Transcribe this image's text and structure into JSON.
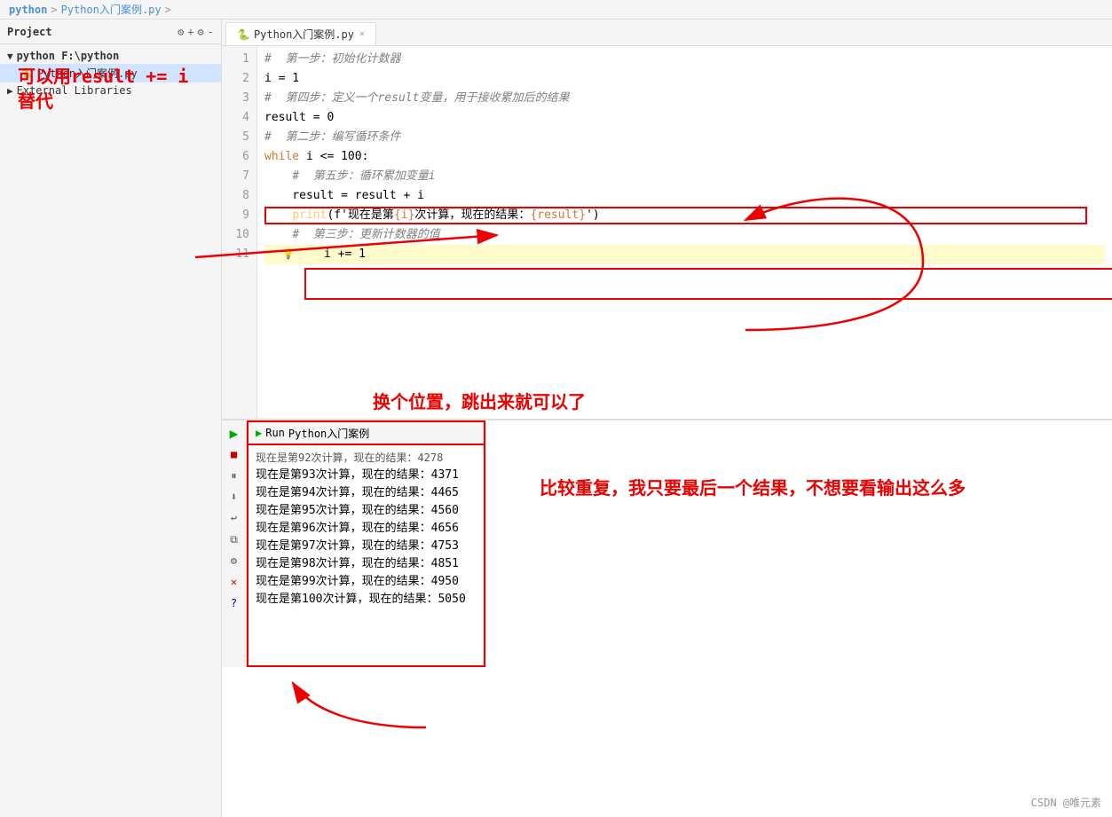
{
  "breadcrumb": {
    "parts": [
      "python",
      ">",
      "Python入门案例.py",
      ">"
    ]
  },
  "sidebar": {
    "title": "Project",
    "items": [
      {
        "label": "python  F:\\python",
        "type": "root",
        "icon": "▼"
      },
      {
        "label": "Python入门案例.py",
        "type": "file",
        "icon": "🐍"
      },
      {
        "label": "External Libraries",
        "type": "lib",
        "icon": "▶ ||||"
      }
    ]
  },
  "editor": {
    "tab": {
      "label": "Python入门案例.py",
      "close": "✕"
    },
    "lines": [
      {
        "num": 1,
        "code": "#  第一步：初始化计数器",
        "type": "comment"
      },
      {
        "num": 2,
        "code": "i = 1",
        "type": "code"
      },
      {
        "num": 3,
        "code": "#  第四步：定义一个result变量，用于接收累加后的结果",
        "type": "comment"
      },
      {
        "num": 4,
        "code": "result = 0",
        "type": "code"
      },
      {
        "num": 5,
        "code": "#  第二步：编写循环条件",
        "type": "comment"
      },
      {
        "num": 6,
        "code": "while i <= 100:",
        "type": "code"
      },
      {
        "num": 7,
        "code": "    #  第五步：循环累加变量i",
        "type": "comment"
      },
      {
        "num": 8,
        "code": "    result = result + i",
        "type": "code"
      },
      {
        "num": 9,
        "code": "    print(f'现在是第{i}次计算，现在的结果：{result}')",
        "type": "code",
        "highlight": "red"
      },
      {
        "num": 10,
        "code": "    #  第三步：更新计数器的值",
        "type": "comment"
      },
      {
        "num": 11,
        "code": "    i += 1",
        "type": "code",
        "highlight": "yellow"
      }
    ]
  },
  "annotations": {
    "left_text_line1": "可以用result += i",
    "left_text_line2": "替代",
    "bottom_text1": "换个位置，跳出来就可以了",
    "bottom_text2": "比较重复，我只要最后一个结果，不想要看输出这么多"
  },
  "run_panel": {
    "title": "Run",
    "file": "Python入门案例",
    "output": [
      "现在是第92次计算，现在的结果：4278",
      "现在是第93次计算，现在的结果：4371",
      "现在是第94次计算，现在的结果：4465",
      "现在是第95次计算，现在的结果：4560",
      "现在是第96次计算，现在的结果：4656",
      "现在是第97次计算，现在的结果：4753",
      "现在是第98次计算，现在的结果：4851",
      "现在是第99次计算，现在的结果：4950",
      "现在是第100次计算，现在的结果：5050"
    ]
  },
  "watermark": "CSDN @唯元素"
}
